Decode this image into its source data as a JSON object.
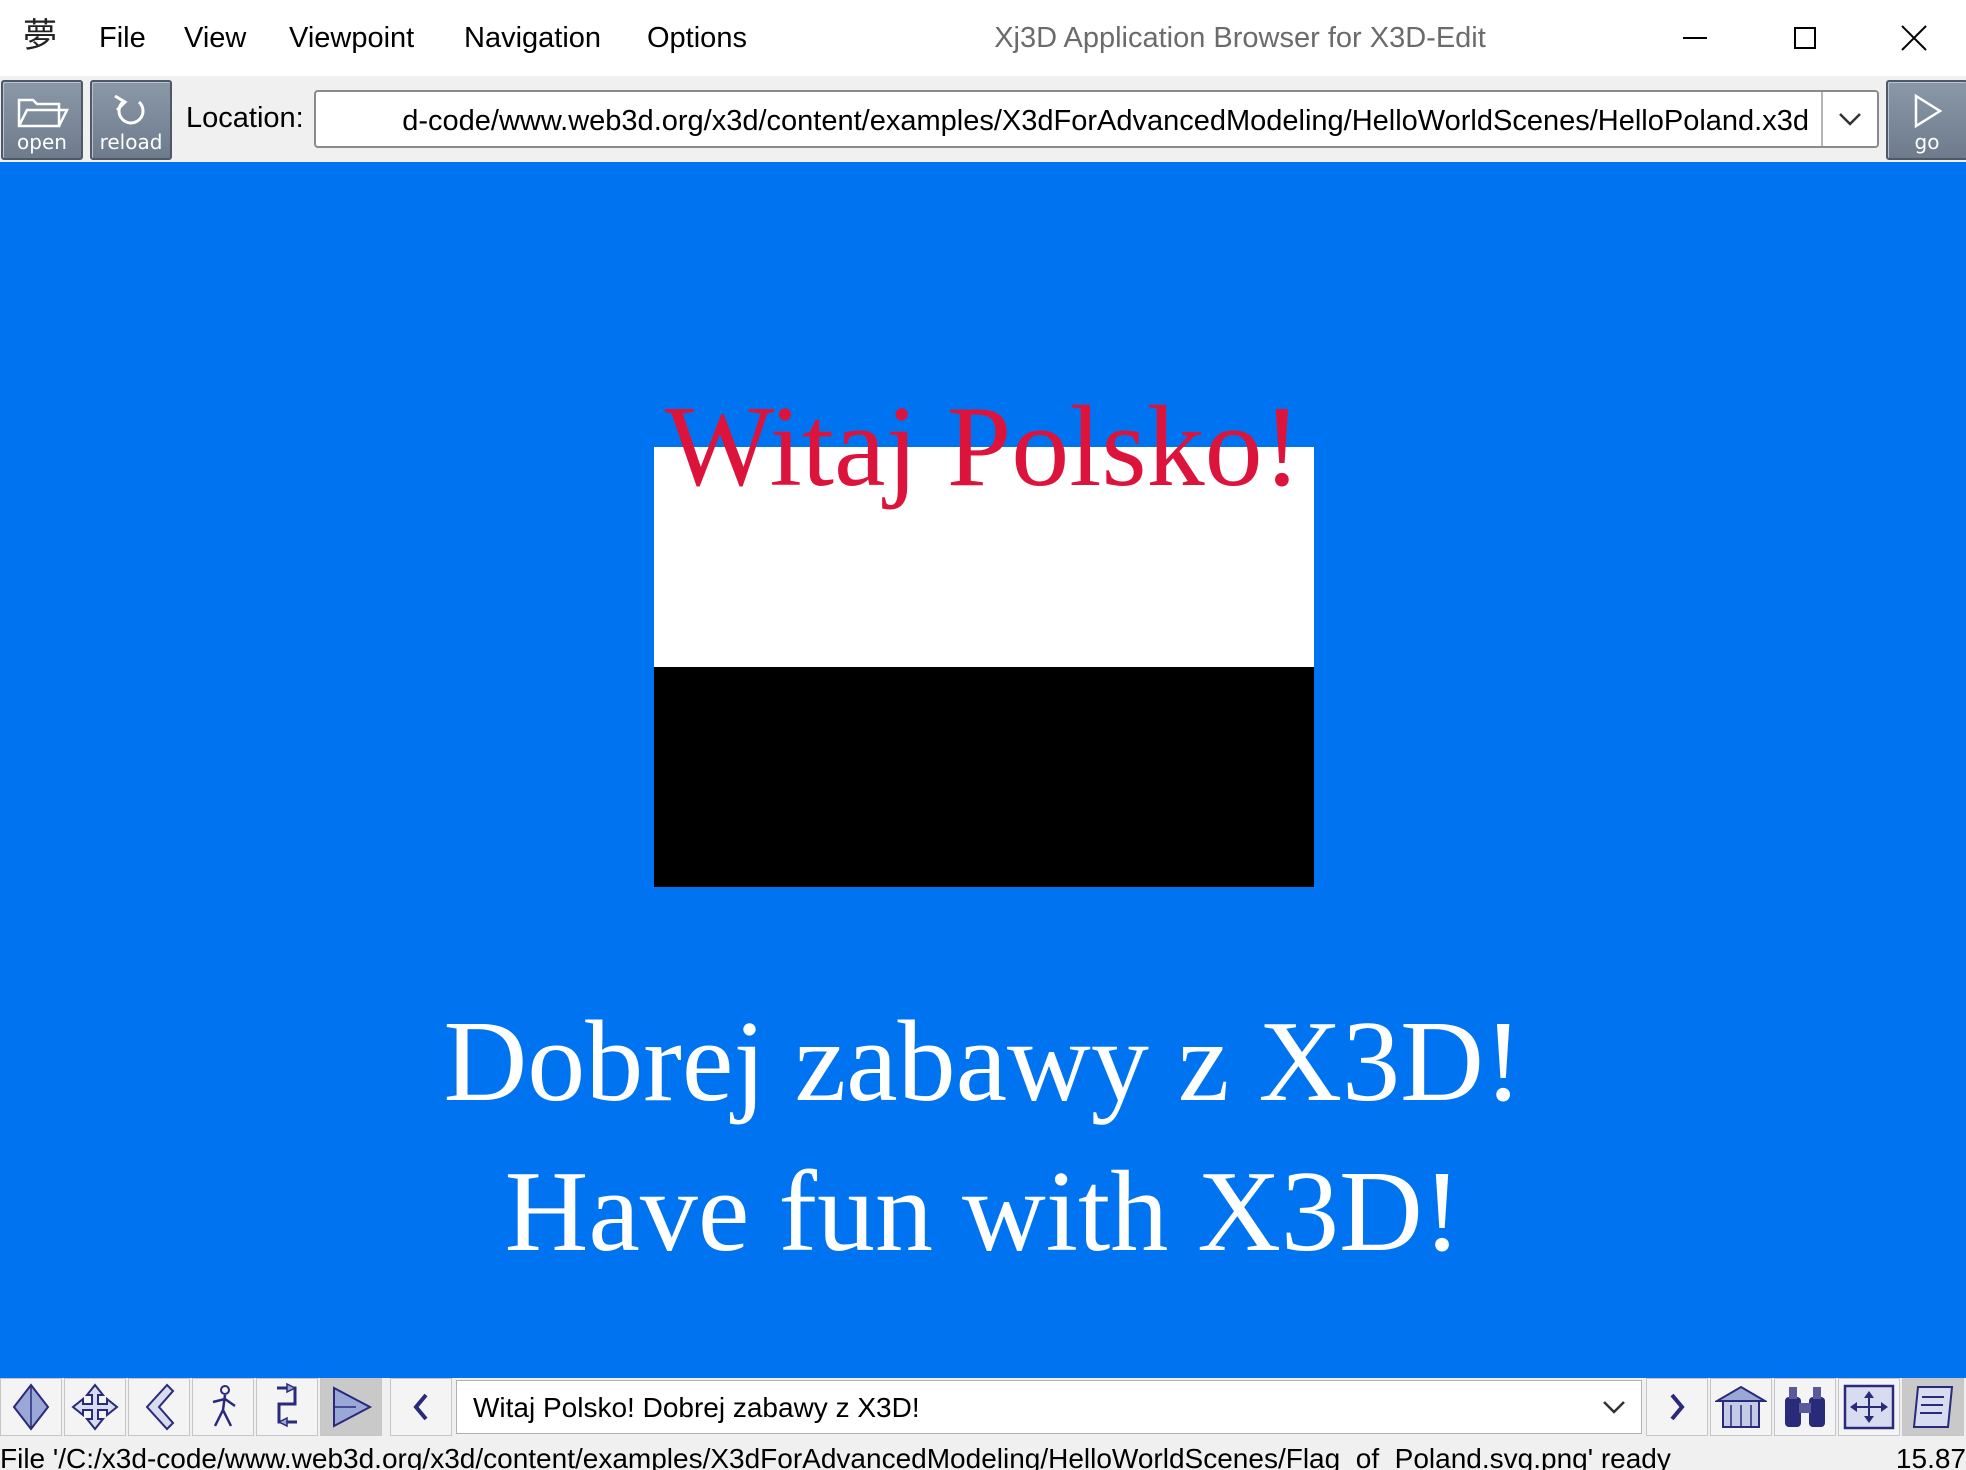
{
  "window": {
    "title": "Xj3D Application Browser for X3D-Edit",
    "logo_glyph": "夢"
  },
  "menu": [
    {
      "label": "File"
    },
    {
      "label": "View"
    },
    {
      "label": "Viewpoint"
    },
    {
      "label": "Navigation"
    },
    {
      "label": "Options"
    }
  ],
  "toolbar": {
    "open_label": "open",
    "reload_label": "reload",
    "go_label": "go",
    "location_label": "Location:",
    "location_value": "d-code/www.web3d.org/x3d/content/examples/X3dForAdvancedModeling/HelloWorldScenes/HelloPoland.x3d"
  },
  "scene": {
    "title_text": "Witaj Polsko!",
    "line_1": "Dobrej zabawy z X3D!",
    "line_2": "Have fun with X3D!",
    "colors": {
      "background": "#0074f0",
      "title": "#dc143c",
      "flag_top": "#ffffff",
      "flag_bottom": "#000000",
      "text": "#ffffff"
    }
  },
  "navbar": {
    "buttons": [
      {
        "icon": "fly-icon"
      },
      {
        "icon": "pan-icon"
      },
      {
        "icon": "tilt-icon"
      },
      {
        "icon": "walk-icon"
      },
      {
        "icon": "examine-icon"
      },
      {
        "icon": "look-at-icon",
        "active": true
      }
    ],
    "prev_icon": "previous-viewpoint-icon",
    "next_icon": "next-viewpoint-icon",
    "viewpoint_selected": "Witaj Polsko! Dobrej zabawy z X3D!",
    "right_icons": [
      "home-viewpoint-icon",
      "binoculars-icon",
      "fit-view-icon",
      "console-icon"
    ]
  },
  "status": {
    "message": "File '/C:/x3d-code/www.web3d.org/x3d/content/examples/X3dForAdvancedModeling/HelloWorldScenes/Flag_of_Poland.svg.png' ready",
    "fps": "15.87"
  }
}
